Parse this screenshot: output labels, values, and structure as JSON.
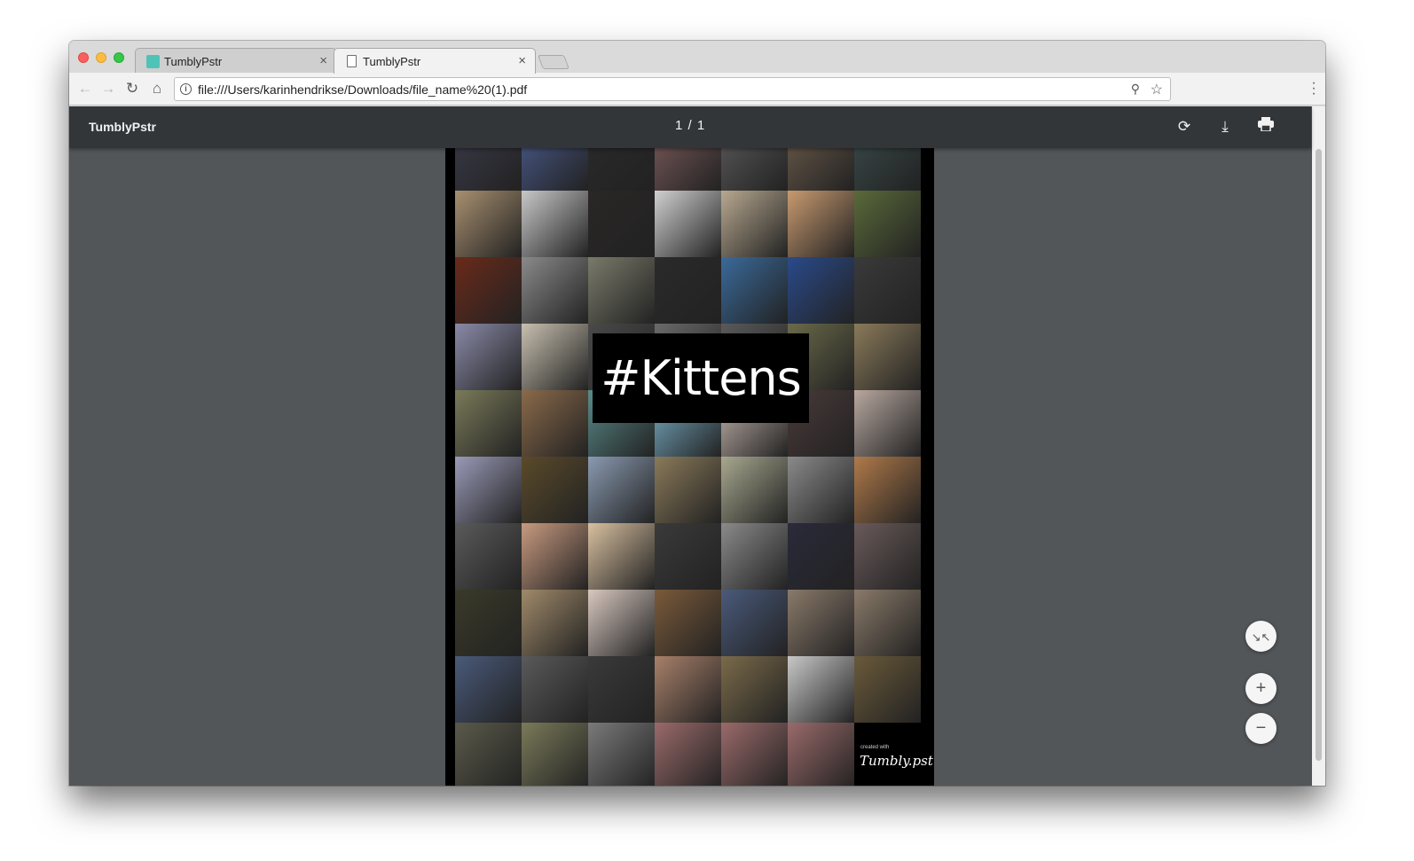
{
  "browser": {
    "tabs": [
      {
        "title": "TumblyPstr",
        "favicon": "pstr",
        "active": false
      },
      {
        "title": "TumblyPstr",
        "favicon": "document-icon",
        "active": true
      }
    ],
    "tab_close": "×",
    "address": "file:///Users/karinhendrikse/Downloads/file_name%20(1).pdf"
  },
  "pdf_viewer": {
    "title": "TumblyPstr",
    "page_indicator": "1 / 1",
    "tools": [
      "rotate-icon",
      "download-icon",
      "print-icon"
    ]
  },
  "poster": {
    "headline": "#Kittens",
    "credit_small": "created with",
    "credit_logo": "Tumbly.pstr",
    "tile_colors": [
      "#3a3a4a",
      "#4a5a8a",
      "#2a2a2a",
      "#7a5a5a",
      "#5a5a5a",
      "#6a5a4a",
      "#3a4a4a",
      "#a89070",
      "#c8c8c8",
      "#2a2626",
      "#d0d0d0",
      "#b8a890",
      "#c89a70",
      "#5a6a3a",
      "#6a2a1a",
      "#8a8a8a",
      "#7a7a6a",
      "#2a2a2a",
      "#3a6a9a",
      "#2a4a8a",
      "#3a3a3a",
      "#8a8aa8",
      "#c8c0b0",
      "#4a4a4a",
      "#6a6a6a",
      "#5a5a5a",
      "#6a6a4a",
      "#8a7a5a",
      "#7a7a5a",
      "#8a6a4a",
      "#5a8a8a",
      "#7ab0c8",
      "#c8b8b0",
      "#4a3a3a",
      "#b8a8a0",
      "#9a9ab8",
      "#5a4a2a",
      "#8a9ab0",
      "#8a7a5a",
      "#a8a890",
      "#8a8a8a",
      "#b07a4a",
      "#5a5a5a",
      "#c89a80",
      "#d8c0a0",
      "#3a3a3a",
      "#8a8a8a",
      "#2a2a3a",
      "#6a5a5a",
      "#3a3a2a",
      "#a08a6a",
      "#d8c8c0",
      "#7a5a3a",
      "#4a5a7a",
      "#8a7a6a",
      "#8a7a6a",
      "#4a5a7a",
      "#5a5a5a",
      "#3a3a3a",
      "#a8806a",
      "#7a6a4a",
      "#c8c8c8",
      "#6a5a3a",
      "#5a5a4a",
      "#7a7a5a",
      "#7a7a7a",
      "#9a6a6a",
      "#9a6a6a",
      "#9a6a6a",
      "#000000"
    ]
  },
  "zoom_controls": {
    "fit": "fit-page-icon",
    "zoom_in": "+",
    "zoom_out": "−"
  }
}
